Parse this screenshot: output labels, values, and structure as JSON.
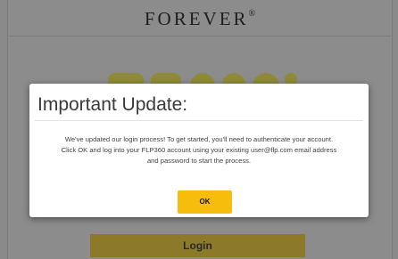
{
  "header": {
    "brand": "FOREVER",
    "brand_mark": "®"
  },
  "underlay": {
    "login_label": "Login"
  },
  "modal": {
    "title": "Important Update:",
    "message_line1": "We've updated our login process! To get started, you'll need to authenticate your account.",
    "message_line2": "Click OK and log into your FLP360 account using your existing user@flp.com email address",
    "message_line3": "and password to start the process.",
    "ok_label": "OK"
  },
  "colors": {
    "ok_button": "#f6bd0c",
    "backdrop": "#8c8c8c"
  }
}
